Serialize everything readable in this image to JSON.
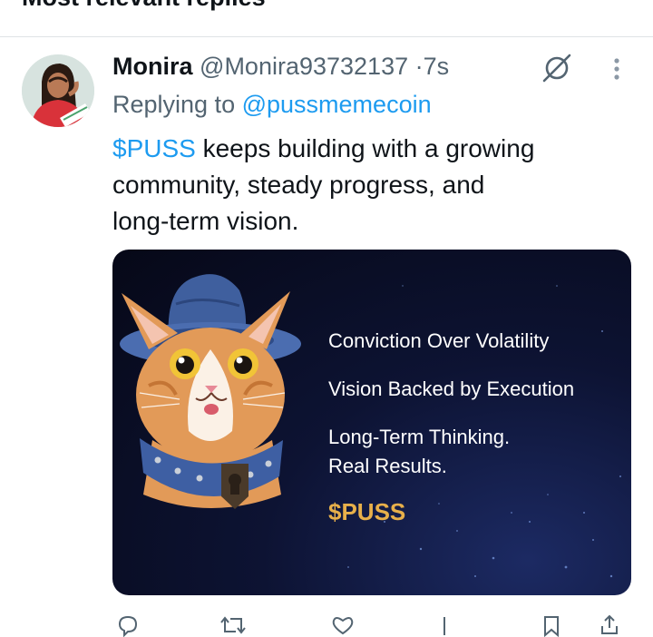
{
  "header": {
    "title": "Most relevant replies"
  },
  "reply": {
    "display_name": "Monira",
    "handle": "@Monira93732137",
    "separator": "·",
    "time": "7s",
    "replying_prefix": "Replying to",
    "replying_to": "@pussmemecoin",
    "text_cashtag": "$PUSS",
    "text_line1_rest": " keeps building with a growing",
    "text_line2": "community, steady progress, and",
    "text_line3": "long-term vision."
  },
  "media": {
    "line1": "Conviction Over Volatility",
    "line2": "Vision Backed by Execution",
    "line3a": "Long-Term Thinking.",
    "line3b": "Real Results.",
    "ticker": "$PUSS"
  },
  "icons": {
    "grok": "grok-icon",
    "more": "more-vertical-icon",
    "actions": [
      "reply-icon",
      "retweet-icon",
      "like-icon",
      "views-icon",
      "bookmark-icon",
      "share-icon"
    ]
  },
  "colors": {
    "link": "#1d9bf0",
    "secondary_text": "#536471",
    "media_gold": "#e8b04a",
    "media_background": "#0d1333"
  }
}
